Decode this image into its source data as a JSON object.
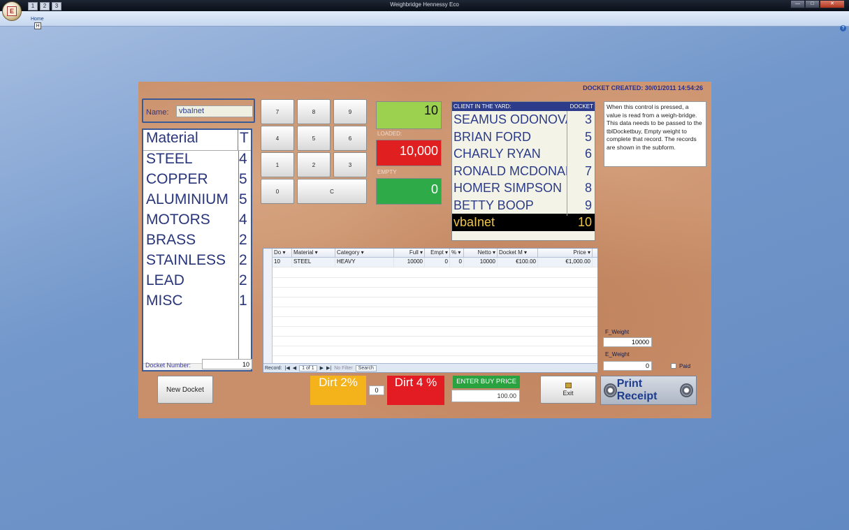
{
  "window": {
    "title": "Weighbridge Hennessy Eco",
    "office_button_letter": "E",
    "qat_keys": [
      "1",
      "2",
      "3"
    ]
  },
  "ribbon": {
    "tab": "Home",
    "keytip": "H"
  },
  "form": {
    "docket_created": "DOCKET CREATED:  30/01/2011 14:54:26",
    "name_label": "Name:",
    "name_value": "vbaInet",
    "materials": {
      "header": [
        "Material",
        "T"
      ],
      "rows": [
        {
          "name": "STEEL",
          "t": "4"
        },
        {
          "name": "COPPER",
          "t": "5"
        },
        {
          "name": "ALUMINIUM",
          "t": "5"
        },
        {
          "name": "MOTORS",
          "t": "4"
        },
        {
          "name": "BRASS",
          "t": "2"
        },
        {
          "name": "STAINLESS",
          "t": "2"
        },
        {
          "name": "LEAD",
          "t": "2"
        },
        {
          "name": "MISC",
          "t": "1"
        }
      ]
    },
    "docket_number_label": "Docket Number:",
    "docket_number": "10",
    "keypad": [
      "7",
      "8",
      "9",
      "4",
      "5",
      "6",
      "1",
      "2",
      "3",
      "0",
      "C"
    ],
    "display_top": "10",
    "loaded_label": "LOADED:",
    "loaded_value": "10,000",
    "empty_label": "EMPTY",
    "empty_value": "0",
    "clients": {
      "header_name": "CLIENT IN THE YARD:",
      "header_docket": "DOCKET #",
      "rows": [
        {
          "name": "SEAMUS ODONOVAN",
          "docket": "3"
        },
        {
          "name": "BRIAN FORD",
          "docket": "5"
        },
        {
          "name": "CHARLY RYAN",
          "docket": "6"
        },
        {
          "name": "RONALD MCDONALD",
          "docket": "7"
        },
        {
          "name": "HOMER SIMPSON",
          "docket": "8"
        },
        {
          "name": "BETTY BOOP",
          "docket": "9"
        },
        {
          "name": "vbaInet",
          "docket": "10"
        }
      ]
    },
    "note": "When this control is pressed, a value is read from a weigh-bridge. This data needs to be passed to the tblDocketbuy, Empty weight to complete that record. The records are shown in the subform.",
    "subform": {
      "headers": [
        "Do ▾",
        "Material ▾",
        "Category ▾",
        "Full ▾",
        "Empt ▾",
        "% ▾",
        "Netto ▾",
        "Docket M ▾",
        "Price ▾"
      ],
      "rows": [
        [
          "10",
          "STEEL",
          "HEAVY",
          "10000",
          "0",
          "0",
          "10000",
          "€100.00",
          "€1,000.00"
        ]
      ],
      "nav": {
        "record_label": "Record:",
        "position": "1 of 1",
        "filter": "No Filter",
        "search": "Search"
      }
    },
    "f_weight_label": "F_Weight",
    "f_weight": "10000",
    "e_weight_label": "E_Weight",
    "e_weight": "0",
    "paid_label": "Paid",
    "new_docket": "New Docket",
    "dirt2": "Dirt 2%",
    "dirt_value": "0",
    "dirt4": "Dirt 4 %",
    "enter_buy_price": "ENTER BUY PRICE",
    "buy_price": "100.00",
    "exit": "Exit",
    "print_receipt": "Print Receipt",
    "colors": {
      "green": "#9bd14f",
      "red": "#e02020",
      "green2": "#2eaa48",
      "dirt2": "#f4b21b",
      "dirt4": "#e21c22"
    }
  }
}
